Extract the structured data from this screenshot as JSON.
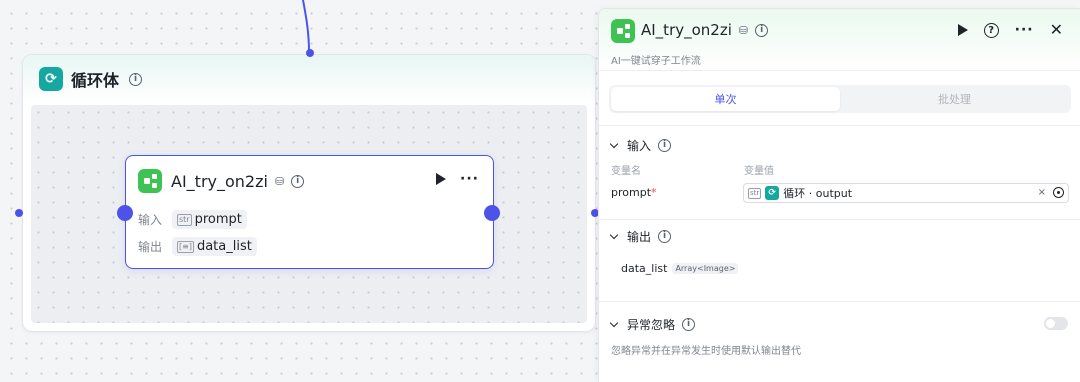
{
  "canvas": {
    "loop": {
      "title": "循环体",
      "icon": "loop-icon"
    },
    "node": {
      "title": "AI_try_on2zi",
      "icon": "workflow-icon",
      "input_label": "输入",
      "input_value": "prompt",
      "output_label": "输出",
      "output_value": "data_list"
    }
  },
  "panel": {
    "title": "AI_try_on2zi",
    "subtitle": "AI一键试穿子工作流",
    "tabs": [
      {
        "label": "单次",
        "active": true
      },
      {
        "label": "批处理",
        "active": false
      }
    ],
    "input_section": {
      "title": "输入",
      "col_name": "变量名",
      "col_value": "变量值",
      "field_name": "prompt",
      "required_mark": "*",
      "ref_text": "循环 · output"
    },
    "output_section": {
      "title": "输出",
      "var_name": "data_list",
      "var_type": "Array<Image>"
    },
    "ignore_section": {
      "title": "异常忽略",
      "description": "忽略异常并在异常发生时使用默认输出替代",
      "enabled": false
    }
  },
  "colors": {
    "accent": "#4d53e8",
    "loop": "#15a8a0",
    "workflow": "#3ec254"
  }
}
